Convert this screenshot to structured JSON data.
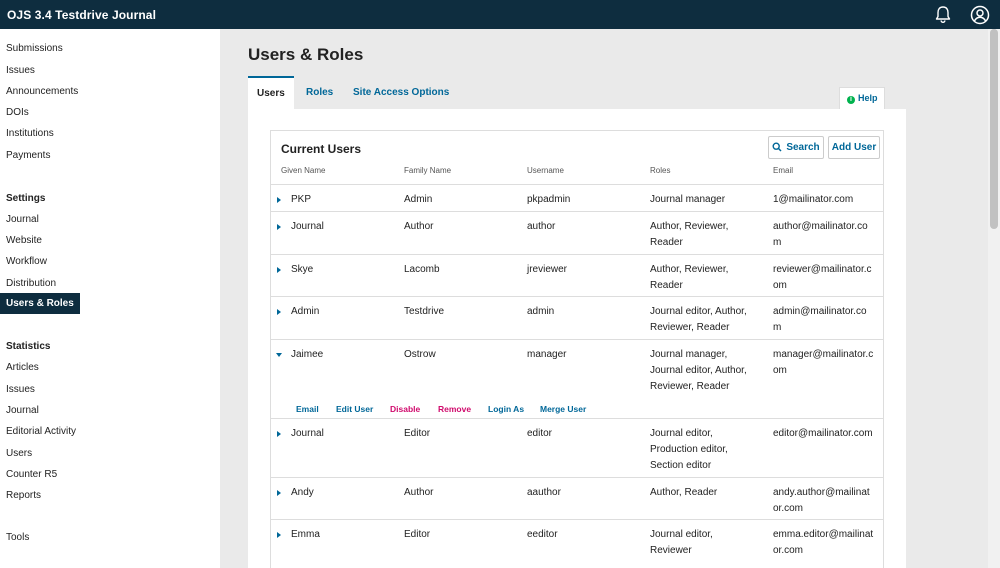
{
  "app": {
    "title": "OJS 3.4 Testdrive Journal"
  },
  "sidebar": {
    "items": [
      {
        "label": "Submissions"
      },
      {
        "label": "Issues"
      },
      {
        "label": "Announcements"
      },
      {
        "label": "DOIs"
      },
      {
        "label": "Institutions"
      },
      {
        "label": "Payments"
      }
    ],
    "settings_heading": "Settings",
    "settings_items": [
      {
        "label": "Journal"
      },
      {
        "label": "Website"
      },
      {
        "label": "Workflow"
      },
      {
        "label": "Distribution"
      },
      {
        "label": "Users & Roles"
      }
    ],
    "statistics_heading": "Statistics",
    "statistics_items": [
      {
        "label": "Articles"
      },
      {
        "label": "Issues"
      },
      {
        "label": "Journal"
      },
      {
        "label": "Editorial Activity"
      },
      {
        "label": "Users"
      },
      {
        "label": "Counter R5"
      },
      {
        "label": "Reports"
      }
    ],
    "tools": "Tools"
  },
  "page": {
    "title": "Users & Roles",
    "help": "Help"
  },
  "tabs": [
    {
      "label": "Users"
    },
    {
      "label": "Roles"
    },
    {
      "label": "Site Access Options"
    }
  ],
  "users": {
    "title": "Current Users",
    "search_label": "Search",
    "add_label": "Add User",
    "columns": [
      "Given Name",
      "Family Name",
      "Username",
      "Roles",
      "Email"
    ],
    "rows": [
      {
        "given": "PKP",
        "family": "Admin",
        "username": "pkpadmin",
        "roles": [
          "Journal manager"
        ],
        "email": [
          "1@mailinator.com"
        ]
      },
      {
        "given": "Journal",
        "family": "Author",
        "username": "author",
        "roles": [
          "Author, Reviewer,",
          "Reader"
        ],
        "email": [
          "author@mailinator.co",
          "m"
        ]
      },
      {
        "given": "Skye",
        "family": "Lacomb",
        "username": "jreviewer",
        "roles": [
          "Author, Reviewer,",
          "Reader"
        ],
        "email": [
          "reviewer@mailinator.c",
          "om"
        ]
      },
      {
        "given": "Admin",
        "family": "Testdrive",
        "username": "admin",
        "roles": [
          "Journal editor, Author,",
          "Reviewer, Reader"
        ],
        "email": [
          "admin@mailinator.co",
          "m"
        ]
      },
      {
        "given": "Jaimee",
        "family": "Ostrow",
        "username": "manager",
        "roles": [
          "Journal manager,",
          "Journal editor, Author,",
          "Reviewer, Reader"
        ],
        "email": [
          "manager@mailinator.c",
          "om"
        ]
      },
      {
        "given": "Journal",
        "family": "Editor",
        "username": "editor",
        "roles": [
          "Journal editor,",
          "Production editor,",
          "Section editor"
        ],
        "email": [
          "editor@mailinator.com"
        ]
      },
      {
        "given": "Andy",
        "family": "Author",
        "username": "aauthor",
        "roles": [
          "Author, Reader"
        ],
        "email": [
          "andy.author@mailinat",
          "or.com"
        ]
      },
      {
        "given": "Emma",
        "family": "Editor",
        "username": "eeditor",
        "roles": [
          "Journal editor,",
          "Reviewer"
        ],
        "email": [
          "emma.editor@mailinat",
          "or.com"
        ]
      }
    ],
    "actions": [
      "Email",
      "Edit User",
      "Disable",
      "Remove",
      "Login As",
      "Merge User"
    ]
  }
}
